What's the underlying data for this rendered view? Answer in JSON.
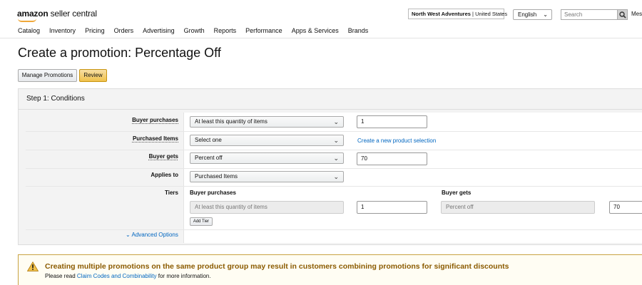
{
  "brand": {
    "strong": "amazon",
    "rest": "seller central"
  },
  "account": {
    "store": "North West Adventures",
    "separator": " | ",
    "region": "United States"
  },
  "language": {
    "selected": "English",
    "chevron": "⌄"
  },
  "search": {
    "placeholder": "Search",
    "partial_label": "Mess"
  },
  "nav": [
    "Catalog",
    "Inventory",
    "Pricing",
    "Orders",
    "Advertising",
    "Growth",
    "Reports",
    "Performance",
    "Apps & Services",
    "Brands"
  ],
  "page": {
    "title": "Create a promotion: Percentage Off",
    "manage_label": "Manage Promotions",
    "review_label": "Review"
  },
  "step": {
    "title": "Step 1: Conditions",
    "rows": {
      "buyer_purchases": {
        "label": "Buyer purchases",
        "select": "At least this quantity of items",
        "value": "1"
      },
      "purchased_items": {
        "label": "Purchased Items",
        "select": "Select one",
        "link": "Create a new product selection"
      },
      "buyer_gets": {
        "label": "Buyer gets",
        "select": "Percent off",
        "value": "70"
      },
      "applies_to": {
        "label": "Applies to",
        "select": "Purchased Items"
      },
      "tiers": {
        "label": "Tiers",
        "col_purchases": "Buyer purchases",
        "col_gets": "Buyer gets",
        "purchases_select": "At least this quantity of items",
        "purchases_value": "1",
        "gets_select": "Percent off",
        "gets_value": "70",
        "add_tier": "Add Tier"
      }
    },
    "advanced": "Advanced Options"
  },
  "alert": {
    "title": "Creating multiple promotions on the same product group may result in customers combining promotions for significant discounts",
    "text_before": "Please read ",
    "link": "Claim Codes and Combinability",
    "text_after": " for more information.",
    "color": "#8b5b00"
  },
  "colors": {
    "link": "#0066c0",
    "review_button": "#f0c14b",
    "accent_smile": "#f0a83a"
  }
}
